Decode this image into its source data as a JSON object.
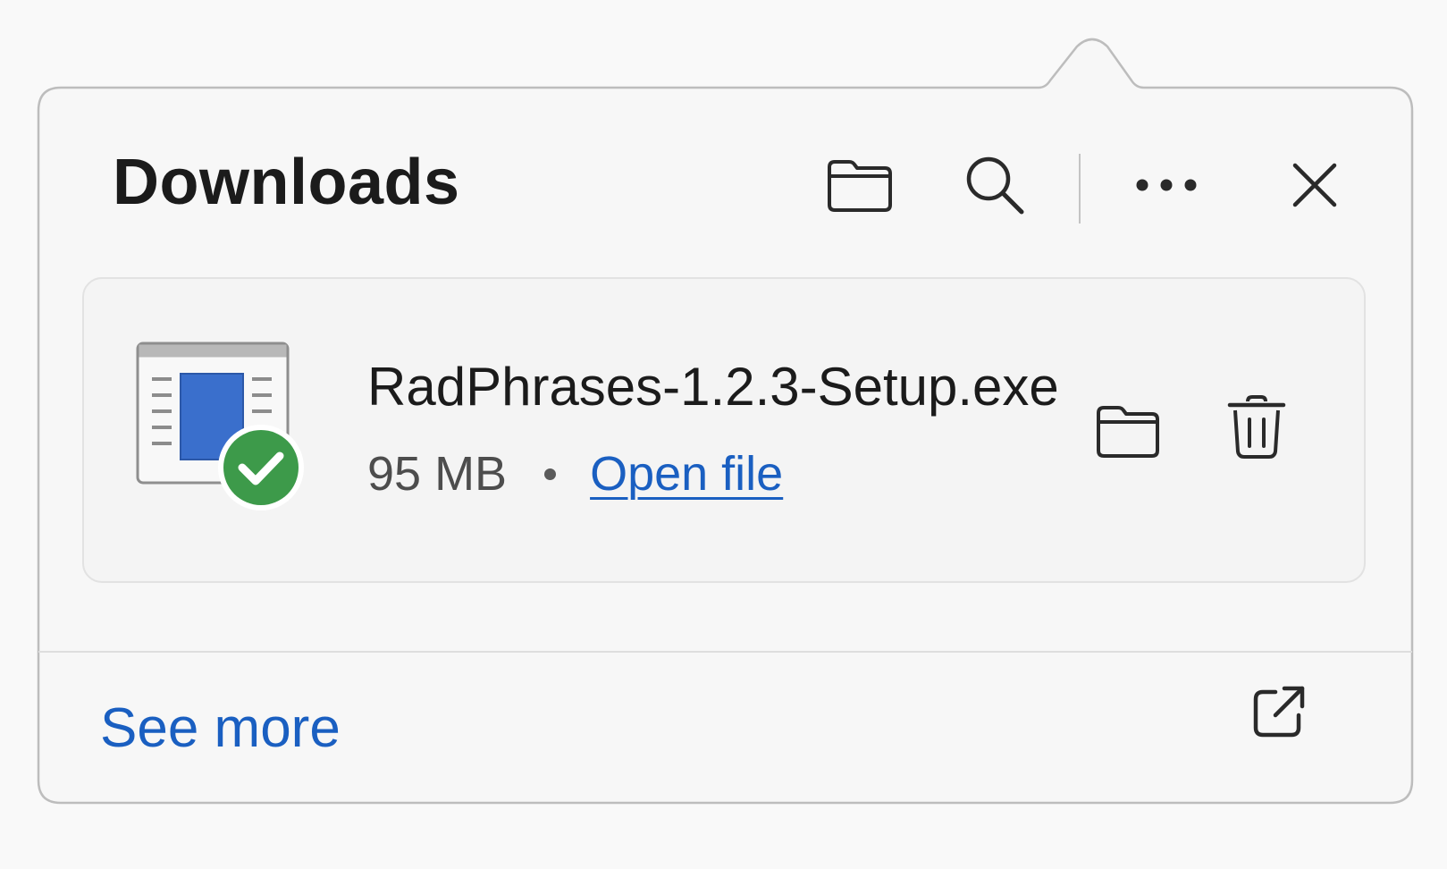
{
  "panel": {
    "title": "Downloads",
    "background": "#f7f7f7",
    "border": "#bdbdbd"
  },
  "header": {
    "buttons": [
      {
        "name": "open-downloads-folder",
        "icon": "folder-icon"
      },
      {
        "name": "search-downloads",
        "icon": "search-icon"
      },
      {
        "name": "more-options",
        "icon": "more-horizontal-icon"
      },
      {
        "name": "close",
        "icon": "close-icon"
      }
    ]
  },
  "download": {
    "file_name": "RadPhrases-1.2.3-Setup.exe",
    "size": "95 MB",
    "open_label": "Open file",
    "status": "completed",
    "status_icon": "checkmark-circle-icon",
    "file_icon": "installer-exe-icon",
    "actions": [
      {
        "name": "show-in-folder",
        "icon": "folder-icon"
      },
      {
        "name": "delete",
        "icon": "trash-icon"
      }
    ]
  },
  "footer": {
    "see_more_label": "See more",
    "external_icon": "open-external-icon"
  },
  "colors": {
    "accent_link": "#1a5fc1",
    "success_green": "#3d9a4a",
    "file_blue": "#3a6fcc",
    "text_primary": "#1b1b1b",
    "text_secondary": "#4d4d4d"
  }
}
